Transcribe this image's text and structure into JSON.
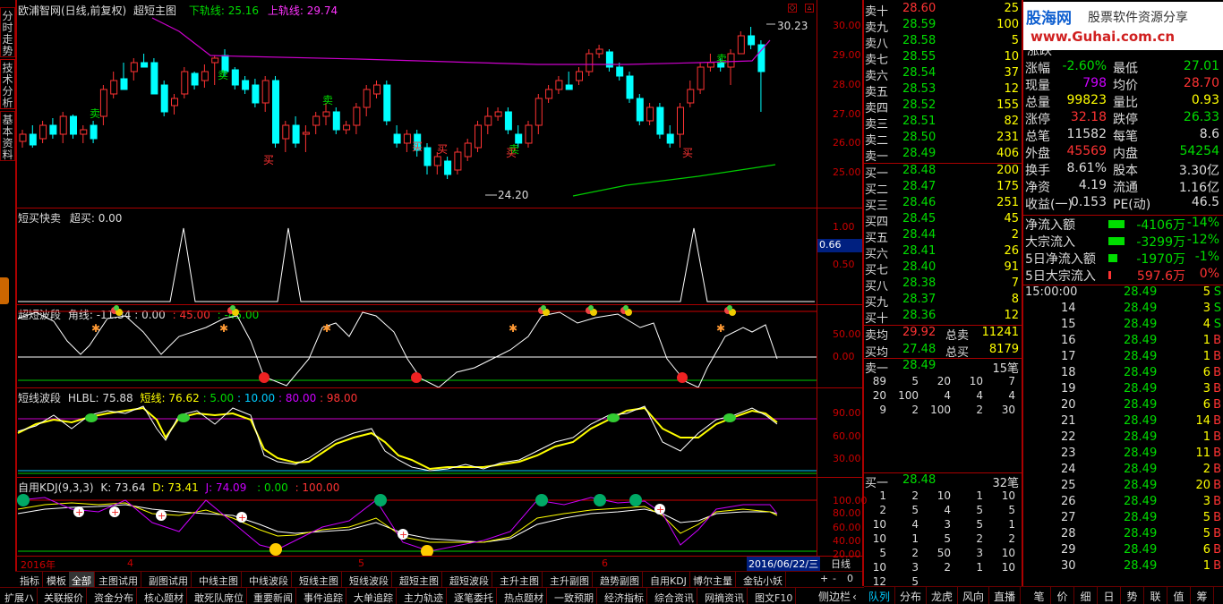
{
  "header": {
    "stock": "欧浦智网(日线,前复权)",
    "indicator": "超短主图",
    "lower_label": "下轨线: 25.16",
    "upper_label": "上轨线: 29.74"
  },
  "side_tabs": [
    "分时走势",
    "技术分析",
    "基本资料"
  ],
  "logo": {
    "title": "股海网",
    "slogan": "股票软件资源分享",
    "url": "www.Guhai.com.cn"
  },
  "main_chart": {
    "price_axis": [
      "30.00",
      "29.00",
      "28.00",
      "27.00",
      "26.00",
      "25.00"
    ],
    "high_label": "30.23",
    "low_label": "24.20",
    "buy_sell_markers": [
      "卖",
      "卖",
      "卖",
      "卖",
      "卖",
      "买",
      "买",
      "买",
      "买",
      "买"
    ]
  },
  "panels": {
    "p1": {
      "title": "短买快卖",
      "value": "超买: 0.00",
      "axis": [
        "1.00",
        "0.50"
      ],
      "current": "0.66"
    },
    "p2": {
      "title": "超短波段",
      "v1": "角线: -11.34",
      "v2": ": 0.00",
      "v3": ": 45.00",
      "v4": ": -45.00",
      "axis": [
        "50.00",
        "0.00"
      ]
    },
    "p3": {
      "title": "短线波段",
      "v1": "HLBL: 75.88",
      "v2": "短线: 76.62",
      "v3": ": 5.00",
      "v4": ": 10.00",
      "v5": ": 80.00",
      "v6": ": 98.00",
      "axis": [
        "90.00",
        "60.00",
        "30.00"
      ]
    },
    "p4": {
      "title": "自用KDJ(9,3,3)",
      "v1": "K: 73.64",
      "v2": "D: 73.41",
      "v3": "J: 74.09",
      "v4": ": 0.00",
      "v5": ": 100.00",
      "axis": [
        "100.00",
        "80.00",
        "60.00",
        "40.00",
        "20.00"
      ]
    }
  },
  "date_axis": {
    "labels": [
      "2016年",
      "4",
      "5",
      "6"
    ],
    "current": "2016/06/22/三",
    "period": "日线"
  },
  "order_book": {
    "sell": [
      {
        "label": "卖十",
        "price": "28.60",
        "vol": "25"
      },
      {
        "label": "卖九",
        "price": "28.59",
        "vol": "100"
      },
      {
        "label": "卖八",
        "price": "28.58",
        "vol": "5"
      },
      {
        "label": "卖七",
        "price": "28.55",
        "vol": "10"
      },
      {
        "label": "卖六",
        "price": "28.54",
        "vol": "37"
      },
      {
        "label": "卖五",
        "price": "28.53",
        "vol": "12"
      },
      {
        "label": "卖四",
        "price": "28.52",
        "vol": "155"
      },
      {
        "label": "卖三",
        "price": "28.51",
        "vol": "82"
      },
      {
        "label": "卖二",
        "price": "28.50",
        "vol": "231"
      },
      {
        "label": "卖一",
        "price": "28.49",
        "vol": "406"
      }
    ],
    "buy": [
      {
        "label": "买一",
        "price": "28.48",
        "vol": "200"
      },
      {
        "label": "买二",
        "price": "28.47",
        "vol": "175"
      },
      {
        "label": "买三",
        "price": "28.46",
        "vol": "251"
      },
      {
        "label": "买四",
        "price": "28.45",
        "vol": "45"
      },
      {
        "label": "买五",
        "price": "28.44",
        "vol": "2"
      },
      {
        "label": "买六",
        "price": "28.41",
        "vol": "26"
      },
      {
        "label": "买七",
        "price": "28.40",
        "vol": "91"
      },
      {
        "label": "买八",
        "price": "28.38",
        "vol": "7"
      },
      {
        "label": "买九",
        "price": "28.37",
        "vol": "8"
      },
      {
        "label": "买十",
        "price": "28.36",
        "vol": "12"
      }
    ],
    "avg_sell_label": "卖均",
    "avg_sell": "29.92",
    "total_sell_label": "总卖",
    "total_sell": "11241",
    "avg_buy_label": "买均",
    "avg_buy": "27.48",
    "total_buy_label": "总买",
    "total_buy": "8179",
    "sell1_label": "卖一",
    "sell1_price": "28.49",
    "sell1_count": "15笔",
    "sell1_queue": [
      [
        "89",
        "5",
        "20",
        "10",
        "7"
      ],
      [
        "20",
        "100",
        "4",
        "4",
        "4"
      ],
      [
        "9",
        "2",
        "100",
        "2",
        "30"
      ]
    ],
    "buy1_label": "买一",
    "buy1_price": "28.48",
    "buy1_count": "32笔",
    "buy1_queue": [
      [
        "1",
        "2",
        "10",
        "1",
        "10"
      ],
      [
        "2",
        "5",
        "4",
        "5",
        "5"
      ],
      [
        "10",
        "4",
        "3",
        "5",
        "1"
      ],
      [
        "10",
        "1",
        "5",
        "2",
        "2"
      ],
      [
        "5",
        "2",
        "50",
        "3",
        "10"
      ],
      [
        "10",
        "3",
        "2",
        "1",
        "10"
      ],
      [
        "12",
        "5"
      ]
    ]
  },
  "stats": {
    "partial_top": "涨跌",
    "rows": [
      {
        "l1": "涨幅",
        "v1": "-2.60%",
        "l2": "最低",
        "v2": "27.01",
        "c1": "#0d0",
        "c2": "#0d0"
      },
      {
        "l1": "现量",
        "v1": "798",
        "l2": "均价",
        "v2": "28.70",
        "c1": "#c0f",
        "c2": "#f33"
      },
      {
        "l1": "总量",
        "v1": "99823",
        "l2": "量比",
        "v2": "0.93",
        "c1": "#ff0",
        "c2": "#ff0"
      },
      {
        "l1": "涨停",
        "v1": "32.18",
        "l2": "跌停",
        "v2": "26.33",
        "c1": "#f33",
        "c2": "#0d0"
      },
      {
        "l1": "总笔",
        "v1": "11582",
        "l2": "每笔",
        "v2": "8.6",
        "c1": "#ddd",
        "c2": "#ddd"
      },
      {
        "l1": "外盘",
        "v1": "45569",
        "l2": "内盘",
        "v2": "54254",
        "c1": "#f33",
        "c2": "#0d0"
      },
      {
        "l1": "换手",
        "v1": "8.61%",
        "l2": "股本",
        "v2": "3.30亿",
        "c1": "#ddd",
        "c2": "#ddd"
      },
      {
        "l1": "净资",
        "v1": "4.19",
        "l2": "流通",
        "v2": "1.16亿",
        "c1": "#ddd",
        "c2": "#ddd"
      },
      {
        "l1": "收益(一)",
        "v1": "0.153",
        "l2": "PE(动)",
        "v2": "46.5",
        "c1": "#ddd",
        "c2": "#ddd"
      }
    ],
    "flows": [
      {
        "label": "净流入额",
        "value": "-4106万",
        "pct": "-14%",
        "color": "#0d0"
      },
      {
        "label": "大宗流入",
        "value": "-3299万",
        "pct": "-12%",
        "color": "#0d0"
      },
      {
        "label": "5日净流入额",
        "value": "-1970万",
        "pct": "-1%",
        "color": "#0d0"
      },
      {
        "label": "5日大宗流入",
        "value": "597.6万",
        "pct": "0%",
        "color": "#f33"
      }
    ]
  },
  "ticks": {
    "rows": [
      {
        "t": "15:00:00",
        "p": "28.49",
        "v": "5",
        "s": "S"
      },
      {
        "t": "14",
        "p": "28.49",
        "v": "3",
        "s": "S"
      },
      {
        "t": "15",
        "p": "28.49",
        "v": "4",
        "s": "S"
      },
      {
        "t": "16",
        "p": "28.49",
        "v": "1",
        "s": "B"
      },
      {
        "t": "17",
        "p": "28.49",
        "v": "1",
        "s": "B"
      },
      {
        "t": "18",
        "p": "28.49",
        "v": "6",
        "s": "B"
      },
      {
        "t": "19",
        "p": "28.49",
        "v": "3",
        "s": "B"
      },
      {
        "t": "20",
        "p": "28.49",
        "v": "6",
        "s": "B"
      },
      {
        "t": "21",
        "p": "28.49",
        "v": "14",
        "s": "B"
      },
      {
        "t": "22",
        "p": "28.49",
        "v": "1",
        "s": "B"
      },
      {
        "t": "23",
        "p": "28.49",
        "v": "11",
        "s": "B"
      },
      {
        "t": "24",
        "p": "28.49",
        "v": "2",
        "s": "B"
      },
      {
        "t": "25",
        "p": "28.49",
        "v": "20",
        "s": "B"
      },
      {
        "t": "26",
        "p": "28.49",
        "v": "3",
        "s": "B"
      },
      {
        "t": "27",
        "p": "28.49",
        "v": "5",
        "s": "B"
      },
      {
        "t": "28",
        "p": "28.49",
        "v": "5",
        "s": "B"
      },
      {
        "t": "29",
        "p": "28.49",
        "v": "6",
        "s": "B"
      },
      {
        "t": "30",
        "p": "28.49",
        "v": "1",
        "s": "B"
      }
    ]
  },
  "bottom_tabs": [
    "指标",
    "模板",
    "全部",
    "主图试用",
    "副图试用",
    "中线主图",
    "中线波段",
    "短线主图",
    "短线波段",
    "超短主图",
    "超短波段",
    "主升主图",
    "主升副图",
    "趋势副图",
    "自用KDJ",
    "博尔主量",
    "金钻小妖"
  ],
  "bottom_tabs2": [
    "扩展ハ",
    "关联报价",
    "资金分布",
    "核心题材",
    "敢死队席位",
    "重要新闻",
    "事件追踪",
    "大单追踪",
    "主力轨迹",
    "逐笔委托",
    "热点题材",
    "一致预期",
    "经济指标",
    "综合资讯",
    "网摘资讯",
    "图文F10"
  ],
  "side_bar_label": "侧边栏",
  "right_tabs": [
    "队列",
    "分布",
    "龙虎",
    "风向",
    "直播",
    "笔",
    "价",
    "细",
    "日",
    "势",
    "联",
    "值",
    "筹"
  ]
}
